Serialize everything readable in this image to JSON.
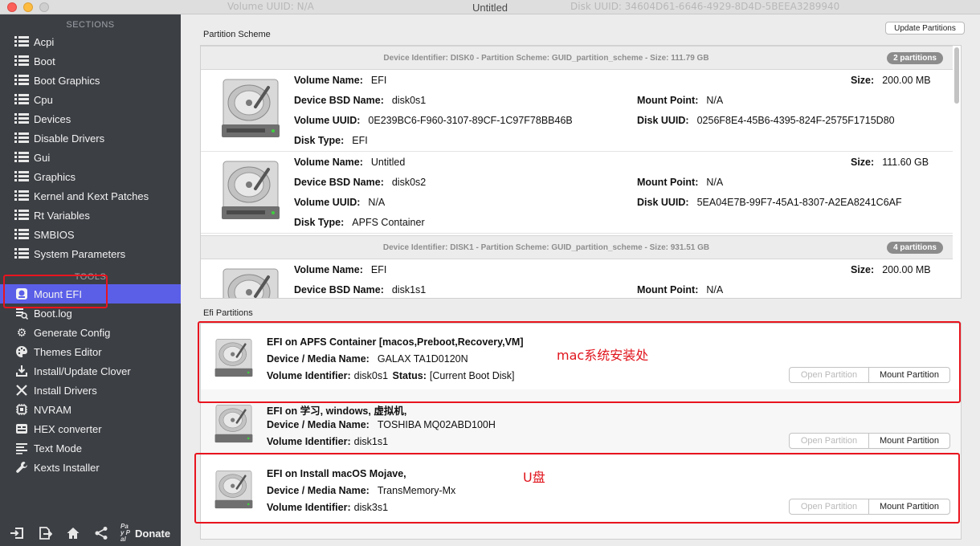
{
  "window": {
    "title": "Untitled",
    "ghost_left": "Volume UUID:  N/A",
    "ghost_right": "Disk UUID:  34604D61-6646-4929-8D4D-5BEEA3289940"
  },
  "sidebar": {
    "sections_header": "SECTIONS",
    "tools_header": "TOOLS",
    "sections": [
      {
        "label": "Acpi"
      },
      {
        "label": "Boot"
      },
      {
        "label": "Boot Graphics"
      },
      {
        "label": "Cpu"
      },
      {
        "label": "Devices"
      },
      {
        "label": "Disable Drivers"
      },
      {
        "label": "Gui"
      },
      {
        "label": "Graphics"
      },
      {
        "label": "Kernel and Kext Patches"
      },
      {
        "label": "Rt Variables"
      },
      {
        "label": "SMBIOS"
      },
      {
        "label": "System Parameters"
      }
    ],
    "tools": [
      {
        "label": "Mount EFI",
        "icon": "disk-icon",
        "active": true
      },
      {
        "label": "Boot.log",
        "icon": "log-icon"
      },
      {
        "label": "Generate Config",
        "icon": "gears-icon"
      },
      {
        "label": "Themes Editor",
        "icon": "palette-icon"
      },
      {
        "label": "Install/Update Clover",
        "icon": "download-icon"
      },
      {
        "label": "Install Drivers",
        "icon": "tools-icon"
      },
      {
        "label": "NVRAM",
        "icon": "chip-icon"
      },
      {
        "label": "HEX converter",
        "icon": "hex-icon"
      },
      {
        "label": "Text Mode",
        "icon": "text-icon"
      },
      {
        "label": "Kexts Installer",
        "icon": "wrench-icon"
      }
    ],
    "bottom": {
      "paypal": "Pay Pal",
      "donate": "Donate"
    }
  },
  "main": {
    "partition_scheme_label": "Partition Scheme",
    "update_button": "Update Partitions",
    "disks": [
      {
        "header": "Device Identifier: DISK0 - Partition Scheme: GUID_partition_scheme - Size: 111.79 GB",
        "badge": "2 partitions",
        "partitions": [
          {
            "volume_name": "EFI",
            "bsd_name": "disk0s1",
            "volume_uuid": "0E239BC6-F960-3107-89CF-1C97F78BB46B",
            "disk_type": "EFI",
            "size": "200.00 MB",
            "mount_point": "N/A",
            "disk_uuid": "0256F8E4-45B6-4395-824F-2575F1715D80"
          },
          {
            "volume_name": "Untitled",
            "bsd_name": "disk0s2",
            "volume_uuid": "N/A",
            "disk_type": "APFS Container",
            "size": "111.60 GB",
            "mount_point": "N/A",
            "disk_uuid": "5EA04E7B-99F7-45A1-8307-A2EA8241C6AF"
          }
        ]
      },
      {
        "header": "Device Identifier: DISK1 - Partition Scheme: GUID_partition_scheme - Size: 931.51 GB",
        "badge": "4 partitions",
        "partitions": [
          {
            "volume_name": "EFI",
            "bsd_name": "disk1s1",
            "size": "200.00 MB",
            "mount_point": "N/A"
          }
        ]
      }
    ],
    "labels": {
      "volume_name": "Volume Name:",
      "bsd_name": "Device BSD Name:",
      "volume_uuid": "Volume UUID:",
      "disk_type": "Disk Type:",
      "size": "Size:",
      "mount_point": "Mount Point:",
      "disk_uuid": "Disk UUID:",
      "media_name": "Device / Media Name:",
      "volume_identifier": "Volume Identifier:",
      "status": "Status:"
    },
    "efi_partitions_label": "Efi Partitions",
    "efi": [
      {
        "title": "EFI on APFS Container [macos,Preboot,Recovery,VM]",
        "media": "GALAX TA1D0120N",
        "identifier": "disk0s1",
        "status": "[Current Boot Disk]",
        "annotation": "mac系统安装处"
      },
      {
        "title": "EFI on 学习, windows, 虚拟机,",
        "media": "TOSHIBA MQ02ABD100H",
        "identifier": "disk1s1"
      },
      {
        "title": "EFI on Install macOS Mojave,",
        "media": "TransMemory-Mx",
        "identifier": "disk3s1",
        "annotation": "U盘"
      }
    ],
    "open_partition": "Open Partition",
    "mount_partition": "Mount Partition"
  }
}
